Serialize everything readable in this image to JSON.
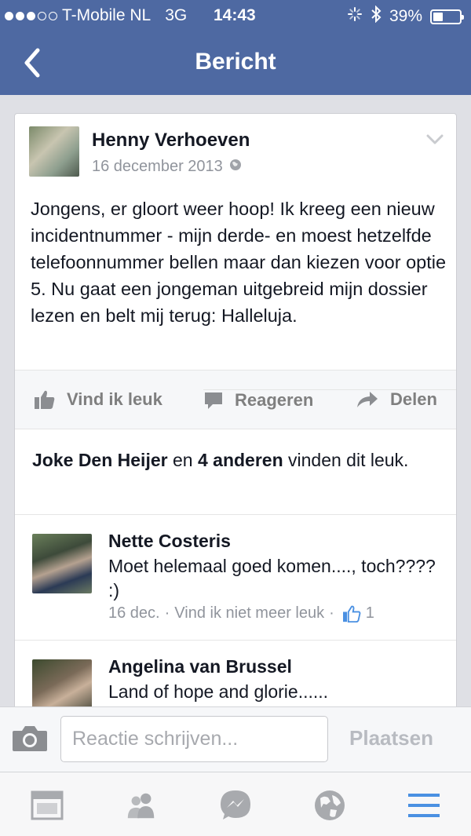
{
  "status_bar": {
    "carrier": "T-Mobile NL",
    "network": "3G",
    "time": "14:43",
    "battery_percent": "39%",
    "battery_level": 0.39,
    "signal_bars_filled": 3,
    "signal_bars_total": 5
  },
  "nav": {
    "title": "Bericht",
    "back_icon": "chevron-left-icon"
  },
  "post": {
    "author": "Henny Verhoeven",
    "date": "16 december 2013",
    "privacy_icon": "globe-icon",
    "text": "Jongens, er gloort weer hoop! Ik kreeg een nieuw incidentnummer - mijn derde- en moest hetzelfde telefoonnummer bellen maar dan kiezen voor optie 5. Nu gaat een jongeman uitgebreid mijn dossier lezen en belt mij terug: Halleluja."
  },
  "actions": {
    "like": "Vind ik leuk",
    "comment": "Reageren",
    "share": "Delen"
  },
  "likes_summary": {
    "name": "Joke Den Heijer",
    "and": "en",
    "others": "4 anderen",
    "suffix": "vinden dit leuk."
  },
  "comments": [
    {
      "name": "Nette Costeris",
      "text": "Moet helemaal goed komen...., toch???? :)",
      "date": "16 dec.",
      "unlike_label": "Vind ik niet meer leuk",
      "like_count": "1"
    },
    {
      "name": "Angelina van Brussel",
      "text": "Land of hope and glorie......"
    }
  ],
  "composer": {
    "placeholder": "Reactie schrijven...",
    "post_label": "Plaatsen"
  },
  "tabs": [
    "news-feed-icon",
    "friends-icon",
    "messenger-icon",
    "globe-notifications-icon",
    "menu-icon"
  ],
  "colors": {
    "header_blue": "#4e69a2",
    "active_tab_blue": "#4a90e2",
    "gray_text": "#90949c"
  }
}
